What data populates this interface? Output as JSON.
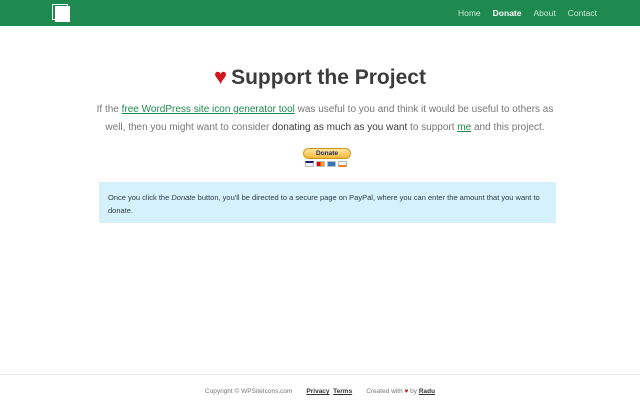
{
  "navbar": {
    "logo_icon": "pages-logo-icon",
    "items": [
      {
        "label": "Home",
        "active": false
      },
      {
        "label": "Donate",
        "active": true
      },
      {
        "label": "About",
        "active": false
      },
      {
        "label": "Contact",
        "active": false
      }
    ]
  },
  "main": {
    "title": "Support the Project",
    "title_icon": "heart-icon",
    "lead": {
      "part1": "If the ",
      "link1": "free WordPress site icon generator tool",
      "part2": " was useful to you and think it would be useful to others as well, then you might want to consider ",
      "emphasis": "donating as much as you want",
      "part3": " to support ",
      "link2": "me",
      "part4": " and this project."
    },
    "donate_button": {
      "label": "Donate",
      "card_icons": [
        "visa-icon",
        "mastercard-icon",
        "amex-icon",
        "discover-icon"
      ]
    },
    "info": {
      "part1": "Once you click the ",
      "emphasis": "Donate",
      "part2": " button, you'll be directed to a secure page on PayPal, where you can enter the amount that you want to donate."
    }
  },
  "footer": {
    "copyright": "Copyright © WPSiteIcons.com",
    "privacy": "Privacy",
    "terms": "Terms",
    "created_with": "Created with ",
    "by": " by ",
    "author": "Radu"
  },
  "colors": {
    "navbar": "#1f8a4f",
    "heart": "#d3141d",
    "info_bg": "#d5f1fb",
    "link": "#1f8a4f"
  }
}
